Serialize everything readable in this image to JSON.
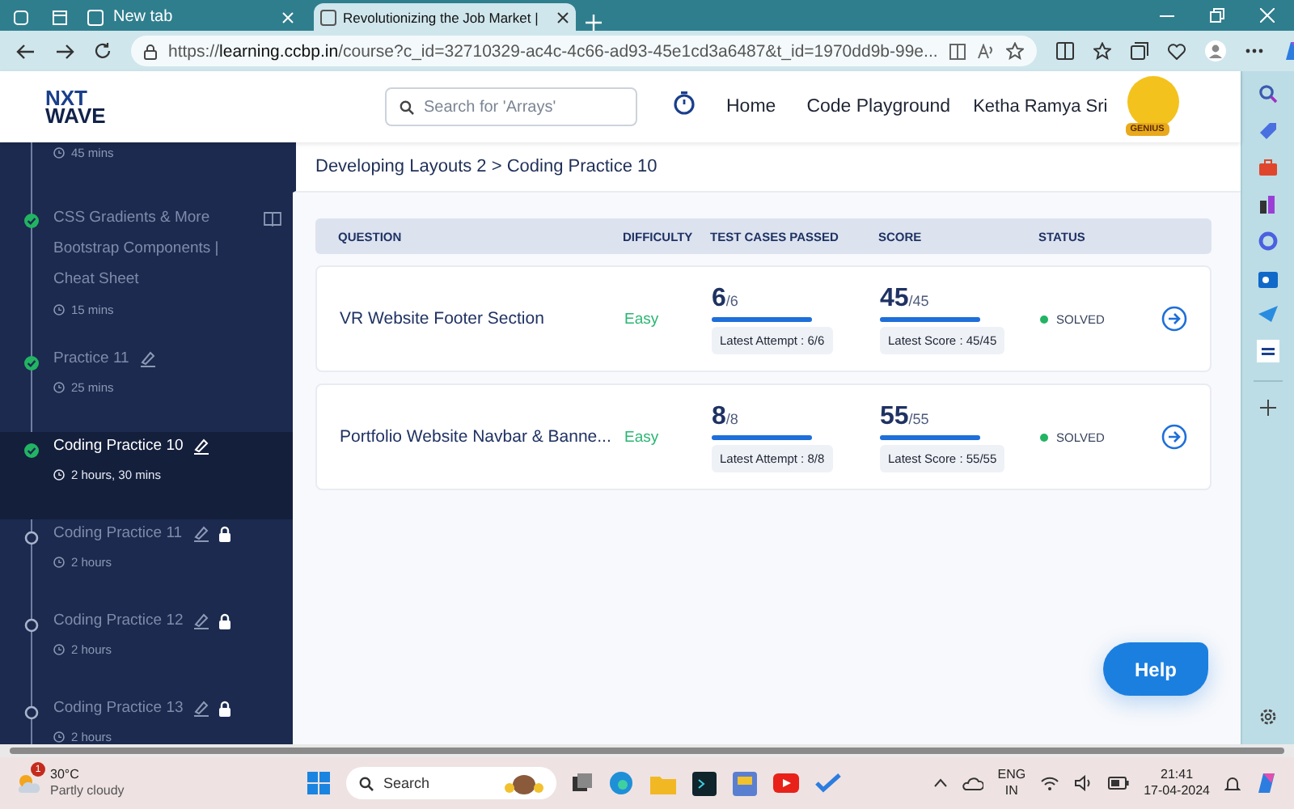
{
  "browser": {
    "tabs": [
      {
        "title": "New tab",
        "selected": false
      },
      {
        "title": "Revolutionizing the Job Market |",
        "selected": true
      }
    ],
    "url": "https://**learning.ccbp.in**/course?c_id=32710329-ac4c-4c66-ad93-45e1cd3a6487&t_id=1970dd9b-99e..."
  },
  "header": {
    "logo": [
      "NXT",
      "WAVE"
    ],
    "search": {
      "placeholder": "Search for 'Arrays'"
    },
    "nav": [
      "Home",
      "Code Playground"
    ],
    "user": "Ketha Ramya Sri",
    "badge": "GENIUS"
  },
  "sidebar": {
    "top_duration": "45 mins",
    "items": [
      {
        "title": "CSS Gradients & More Bootstrap Components | Cheat Sheet",
        "kind": "reading",
        "duration": "15 mins",
        "completed": true,
        "locked": false,
        "selected": false
      },
      {
        "title": "Practice 11",
        "kind": "practice",
        "duration": "25 mins",
        "completed": true,
        "locked": false,
        "selected": false
      },
      {
        "title": "Coding Practice 10",
        "kind": "practice",
        "duration": "2 hours, 30 mins",
        "completed": true,
        "locked": false,
        "selected": true
      },
      {
        "title": "Coding Practice 11",
        "kind": "practice",
        "duration": "2 hours",
        "completed": false,
        "locked": true,
        "selected": false
      },
      {
        "title": "Coding Practice 12",
        "kind": "practice",
        "duration": "2 hours",
        "completed": false,
        "locked": true,
        "selected": false
      },
      {
        "title": "Coding Practice 13",
        "kind": "practice",
        "duration": "2 hours",
        "completed": false,
        "locked": true,
        "selected": false
      }
    ]
  },
  "breadcrumb": "Developing Layouts 2 > Coding Practice 10",
  "table": {
    "columns": [
      "QUESTION",
      "DIFFICULTY",
      "TEST CASES PASSED",
      "SCORE",
      "STATUS"
    ],
    "rows": [
      {
        "question": "VR Website Footer Section",
        "difficulty": "Easy",
        "passed": "6",
        "passed_total": "/6",
        "passed_bar": {
          "level": 1
        },
        "latest_attempt": "Latest Attempt : 6/6",
        "score": "45",
        "score_total": "/45",
        "score_bar": {
          "level": 1
        },
        "latest_score": "Latest Score : 45/45",
        "status": "SOLVED"
      },
      {
        "question": "Portfolio Website Navbar & Banne...",
        "difficulty": "Easy",
        "passed": "8",
        "passed_total": "/8",
        "passed_bar": {
          "level": 1
        },
        "latest_attempt": "Latest Attempt : 8/8",
        "score": "55",
        "score_total": "/55",
        "score_bar": {
          "level": 1
        },
        "latest_score": "Latest Score : 55/55",
        "status": "SOLVED"
      }
    ]
  },
  "help": "Help",
  "taskbar": {
    "weather": {
      "temp": "30°C",
      "desc": "Partly cloudy",
      "badge": "1"
    },
    "search": "Search",
    "lang": [
      "ENG",
      "IN"
    ],
    "time": "21:41",
    "date": "17-04-2024"
  }
}
